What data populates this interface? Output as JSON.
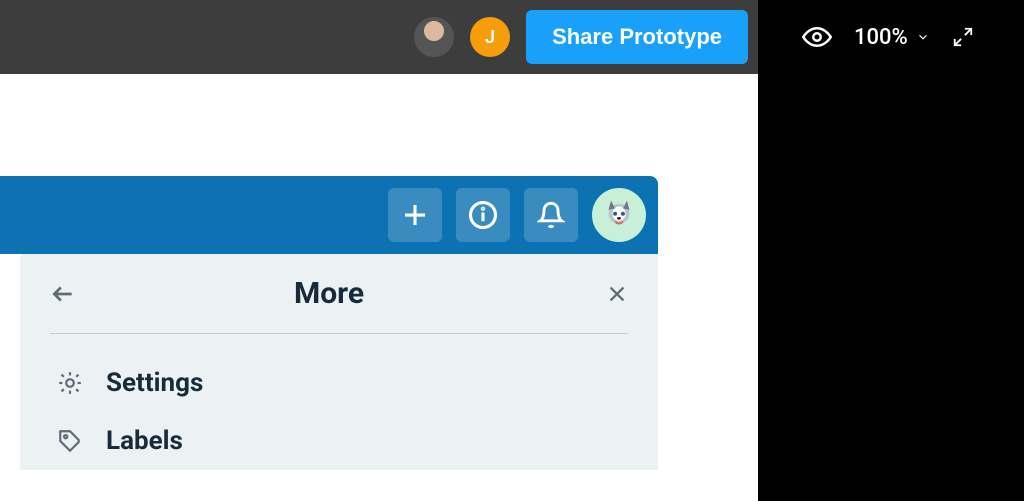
{
  "topbar": {
    "avatar_initial": "J",
    "share_label": "Share Prototype"
  },
  "rightbar": {
    "zoom_level": "100%"
  },
  "app": {
    "panel_title": "More",
    "menu": [
      {
        "label": "Settings"
      },
      {
        "label": "Labels"
      }
    ]
  }
}
